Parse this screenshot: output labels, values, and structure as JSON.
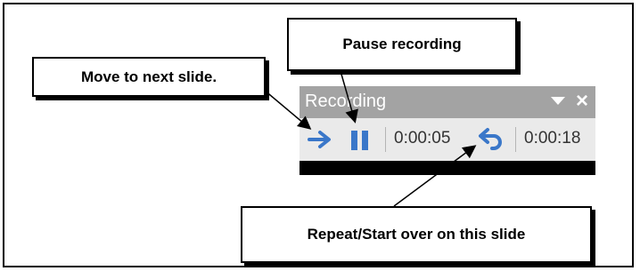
{
  "callouts": {
    "next_slide": "Move to next slide.",
    "pause": "Pause recording",
    "repeat": "Repeat/Start over on this slide"
  },
  "toolbar": {
    "title": "Recording",
    "slide_time": "0:00:05",
    "total_time": "0:00:18",
    "icons": {
      "next": "arrow-right-icon",
      "pause": "pause-icon",
      "repeat": "undo-arrow-icon",
      "dropdown": "chevron-down-icon",
      "close": "close-icon"
    }
  },
  "colors": {
    "accent_blue": "#3a77c9",
    "title_bar": "#a3a3a3",
    "body": "#eaeaea"
  }
}
